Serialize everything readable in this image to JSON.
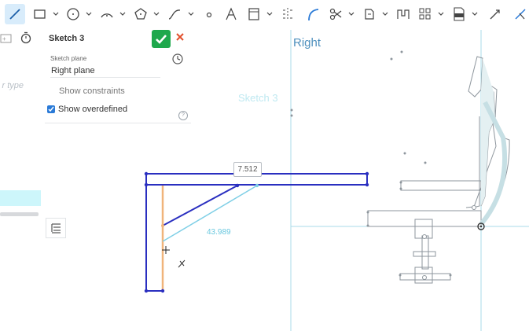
{
  "toolbar": {
    "tools": [
      "line-tool",
      "rectangle-tool",
      "circle-tool",
      "arc-tool",
      "polygon-tool",
      "spline-tool",
      "point-tool",
      "text-tool",
      "image-tool",
      "mirror-tool",
      "fillet-tool",
      "trim-tool",
      "use-tool",
      "offset-tool",
      "pattern-tool",
      "dxf-tool",
      "dimension-tool",
      "construction-tool"
    ],
    "active_tool": "line-tool"
  },
  "feature_panel": {
    "filter_placeholder": "r type"
  },
  "sketch_dialog": {
    "title": "Sketch 3",
    "plane_label": "Sketch plane",
    "plane_value": "Right plane",
    "show_constraints": "Show constraints",
    "show_constraints_checked": false,
    "show_overdefined": "Show overdefined",
    "show_overdefined_checked": true,
    "help": "?"
  },
  "canvas": {
    "view_label": "Right",
    "sketch_label": "Sketch 3",
    "dimension_1": "7.512",
    "dimension_2": "43.989"
  },
  "colors": {
    "accent": "#2a7ad7",
    "ok_green": "#1ea84c",
    "cancel_red": "#e2502d",
    "sketch_blue": "#2a2fc0",
    "preview_cyan": "#7fcfe6",
    "constraint_orange": "#f0b47a"
  }
}
